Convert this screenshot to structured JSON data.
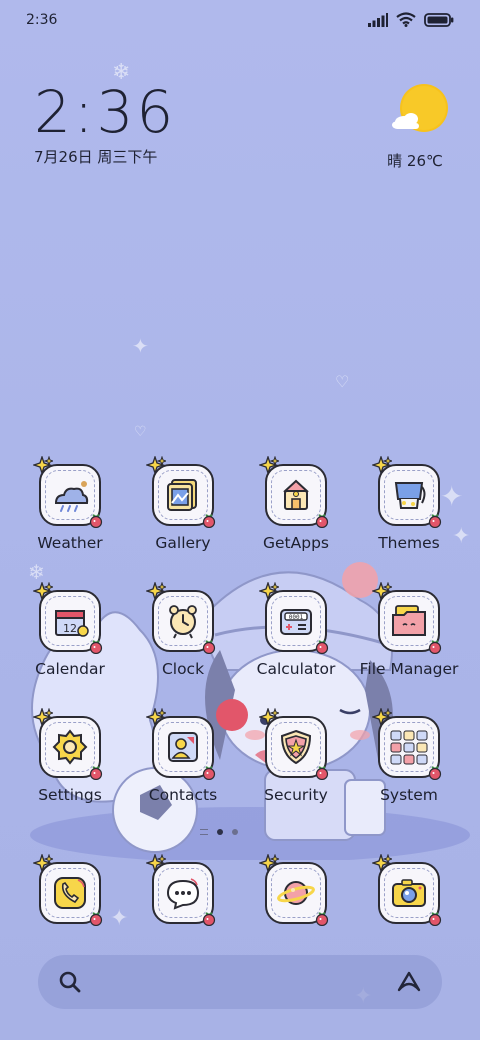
{
  "status_bar": {
    "time": "2:36"
  },
  "clock_widget": {
    "time": "2:36",
    "date": "7月26日 周三下午"
  },
  "weather_widget": {
    "condition": "晴",
    "temperature": "26℃",
    "condition_temperature": "晴 26℃"
  },
  "apps": [
    {
      "label": "Weather",
      "icon": "weather-icon"
    },
    {
      "label": "Gallery",
      "icon": "gallery-icon"
    },
    {
      "label": "GetApps",
      "icon": "getapps-icon"
    },
    {
      "label": "Themes",
      "icon": "themes-icon"
    },
    {
      "label": "Calendar",
      "icon": "calendar-icon",
      "day": "12"
    },
    {
      "label": "Clock",
      "icon": "clock-icon"
    },
    {
      "label": "Calculator",
      "icon": "calculator-icon",
      "display": "0001"
    },
    {
      "label": "File Manager",
      "icon": "file-manager-icon"
    },
    {
      "label": "Settings",
      "icon": "settings-icon"
    },
    {
      "label": "Contacts",
      "icon": "contacts-icon"
    },
    {
      "label": "Security",
      "icon": "security-icon"
    },
    {
      "label": "System",
      "icon": "system-folder-icon"
    }
  ],
  "dock": [
    {
      "icon": "phone-icon"
    },
    {
      "icon": "messages-icon"
    },
    {
      "icon": "browser-icon"
    },
    {
      "icon": "camera-icon"
    }
  ],
  "page_indicator": {
    "current": 1,
    "total": 2
  },
  "search": {
    "icon": "search-icon",
    "assistant_icon": "assistant-icon"
  },
  "colors": {
    "background": "#acb6ea",
    "icon_outline": "#2b2b33",
    "sun": "#f7c21c",
    "berry": "#e2566a"
  }
}
